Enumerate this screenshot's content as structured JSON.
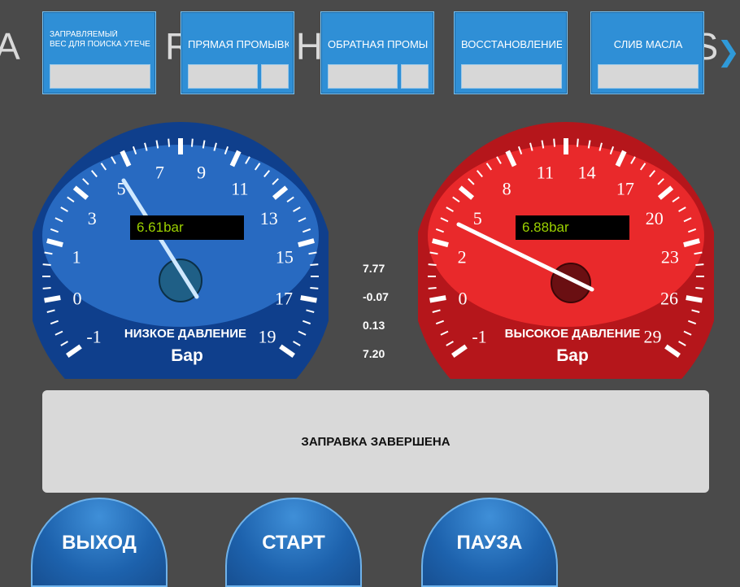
{
  "watermark": {
    "segments": [
      "A",
      "RUSTEHNIKA",
      "RUS"
    ]
  },
  "mode_buttons": [
    {
      "label_line1": "ЗАПРАВЛЯЕМЫЙ",
      "label_line2": "ВЕС ДЛЯ ПОИСКА УТЕЧЕК"
    },
    {
      "label": "ПРЯМАЯ ПРОМЫВКА"
    },
    {
      "label": "ОБРАТНАЯ ПРОМЫВКА"
    },
    {
      "label": "ВОССТАНОВЛЕНИЕ"
    },
    {
      "label": "СЛИВ МАСЛА"
    }
  ],
  "gauge_low": {
    "readout": "6.61bar",
    "title": "НИЗКОЕ ДАВЛЕНИЕ",
    "unit": "Бар",
    "scale_labels": [
      "-1",
      "0",
      "1",
      "3",
      "5",
      "7",
      "9",
      "11",
      "13",
      "15",
      "17",
      "19"
    ],
    "value": 6.61,
    "min": -1,
    "max": 19,
    "color": "#1e5fb8"
  },
  "gauge_high": {
    "readout": "6.88bar",
    "title": "ВЫСОКОЕ ДАВЛЕНИЕ",
    "unit": "Бар",
    "scale_labels": [
      "-1",
      "0",
      "2",
      "5",
      "8",
      "11",
      "14",
      "17",
      "20",
      "23",
      "26",
      "29"
    ],
    "value": 6.88,
    "min": -1,
    "max": 29,
    "color": "#e0151a"
  },
  "side_values": [
    "7.77",
    "-0.07",
    "0.13",
    "7.20"
  ],
  "status": {
    "message": "ЗАПРАВКА ЗАВЕРШЕНА"
  },
  "bottom_buttons": [
    {
      "label": "ВЫХОД"
    },
    {
      "label": "СТАРТ"
    },
    {
      "label": "ПАУЗА"
    }
  ]
}
